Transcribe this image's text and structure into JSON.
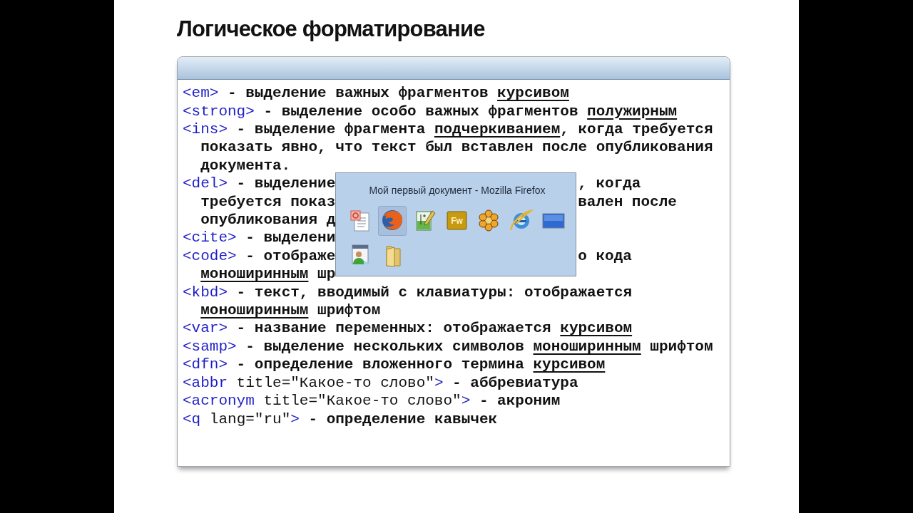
{
  "slide": {
    "title": "Логическое форматирование",
    "lines": [
      {
        "continuation": false,
        "parts": [
          {
            "kind": "tag",
            "text": "<em>"
          },
          {
            "kind": "text",
            "text": " - выделение важных фрагментов "
          },
          {
            "kind": "text",
            "text": "курсивом",
            "underline": true
          }
        ]
      },
      {
        "continuation": false,
        "parts": [
          {
            "kind": "tag",
            "text": "<strong>"
          },
          {
            "kind": "text",
            "text": " - выделение особо важных фрагментов "
          },
          {
            "kind": "text",
            "text": "полужирным",
            "underline": true
          }
        ]
      },
      {
        "continuation": false,
        "parts": [
          {
            "kind": "tag",
            "text": "<ins>"
          },
          {
            "kind": "text",
            "text": " - выделение фрагмента "
          },
          {
            "kind": "text",
            "text": "подчеркиванием",
            "underline": true
          },
          {
            "kind": "text",
            "text": ", когда требуется"
          }
        ]
      },
      {
        "continuation": true,
        "parts": [
          {
            "kind": "text",
            "text": "показать явно, что текст был вставлен после опубликования"
          }
        ]
      },
      {
        "continuation": true,
        "parts": [
          {
            "kind": "text",
            "text": "документа."
          }
        ]
      },
      {
        "continuation": false,
        "parts": [
          {
            "kind": "tag",
            "text": "<del>"
          },
          {
            "kind": "text",
            "text": " - выделение"
          }
        ],
        "after": [
          {
            "kind": "text",
            "text": ", когда"
          }
        ]
      },
      {
        "continuation": true,
        "parts": [
          {
            "kind": "text",
            "text": "требуется показ"
          }
        ],
        "after": [
          {
            "kind": "text",
            "text": "вален после"
          }
        ]
      },
      {
        "continuation": true,
        "parts": [
          {
            "kind": "text",
            "text": "опубликования д"
          }
        ]
      },
      {
        "continuation": false,
        "parts": [
          {
            "kind": "tag",
            "text": "<cite>"
          },
          {
            "kind": "text",
            "text": " - выделени"
          }
        ]
      },
      {
        "continuation": false,
        "parts": [
          {
            "kind": "tag",
            "text": "<code>"
          },
          {
            "kind": "text",
            "text": " - отображе"
          }
        ],
        "after": [
          {
            "kind": "text",
            "text": "о кода"
          }
        ]
      },
      {
        "continuation": true,
        "parts": [
          {
            "kind": "text",
            "text": "моноширинным",
            "underline": true
          },
          {
            "kind": "text",
            "text": " шр"
          }
        ]
      },
      {
        "continuation": false,
        "parts": [
          {
            "kind": "tag",
            "text": "<kbd>"
          },
          {
            "kind": "text",
            "text": " - текст, вводимый с клавиатуры: отображается"
          }
        ]
      },
      {
        "continuation": true,
        "parts": [
          {
            "kind": "text",
            "text": "моноширинным",
            "underline": true
          },
          {
            "kind": "text",
            "text": " шрифтом"
          }
        ]
      },
      {
        "continuation": false,
        "parts": [
          {
            "kind": "tag",
            "text": "<var>"
          },
          {
            "kind": "text",
            "text": " - название переменных: отображается "
          },
          {
            "kind": "text",
            "text": "курсивом",
            "underline": true
          }
        ]
      },
      {
        "continuation": false,
        "parts": [
          {
            "kind": "tag",
            "text": "<samp>"
          },
          {
            "kind": "text",
            "text": " - выделение нескольких символов "
          },
          {
            "kind": "text",
            "text": "моноширинным",
            "underline": true
          },
          {
            "kind": "text",
            "text": " шрифтом"
          }
        ]
      },
      {
        "continuation": false,
        "parts": [
          {
            "kind": "tag",
            "text": "<dfn>"
          },
          {
            "kind": "text",
            "text": " - определение вложенного термина "
          },
          {
            "kind": "text",
            "text": "курсивом",
            "underline": true
          }
        ]
      },
      {
        "continuation": false,
        "parts": [
          {
            "kind": "tag",
            "text": "<abbr"
          },
          {
            "kind": "attr",
            "text": " title=\"Какое-то слово\""
          },
          {
            "kind": "tag",
            "text": ">"
          },
          {
            "kind": "text",
            "text": " - аббревиатура"
          }
        ]
      },
      {
        "continuation": false,
        "parts": [
          {
            "kind": "tag",
            "text": "<acronym"
          },
          {
            "kind": "attr",
            "text": " title=\"Какое-то слово\""
          },
          {
            "kind": "tag",
            "text": ">"
          },
          {
            "kind": "text",
            "text": " - акроним"
          }
        ]
      },
      {
        "continuation": false,
        "parts": [
          {
            "kind": "tag",
            "text": "<q"
          },
          {
            "kind": "attr",
            "text": " lang=\"ru\""
          },
          {
            "kind": "tag",
            "text": ">"
          },
          {
            "kind": "text",
            "text": " - определение кавычек"
          }
        ]
      }
    ]
  },
  "taskbar_popup": {
    "title": "Мой первый документ - Mozilla Firefox",
    "items": [
      {
        "kind": "document",
        "selected": false
      },
      {
        "kind": "fox-browser",
        "selected": true
      },
      {
        "kind": "editor",
        "selected": false
      },
      {
        "kind": "fw",
        "label": "Fw",
        "selected": false
      },
      {
        "kind": "flower",
        "selected": false
      },
      {
        "kind": "e-browser",
        "selected": false
      },
      {
        "kind": "monitor",
        "selected": false
      },
      {
        "kind": "contacts",
        "selected": false
      },
      {
        "kind": "folder",
        "selected": false
      }
    ]
  }
}
